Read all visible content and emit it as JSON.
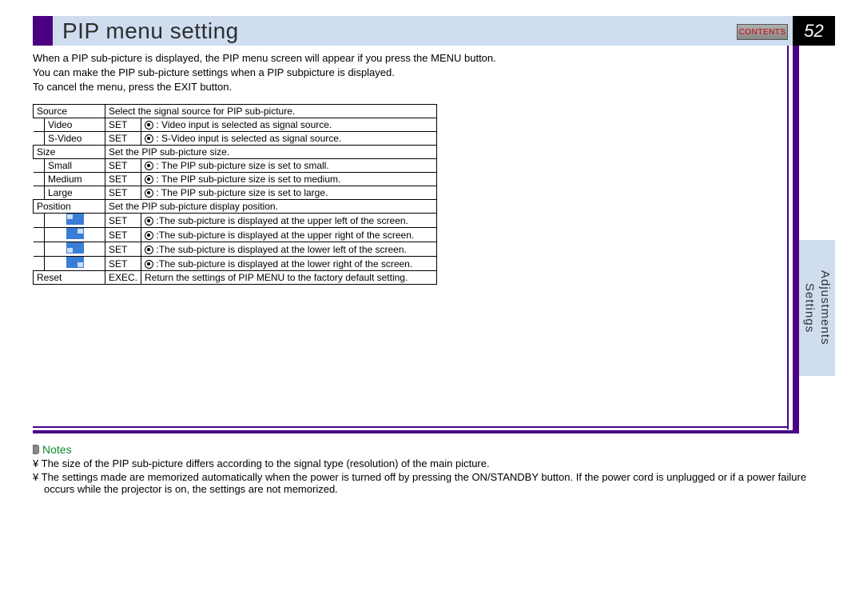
{
  "header": {
    "title": "PIP menu setting",
    "contents_label": "CONTENTS",
    "page_number": "52"
  },
  "side_tab": {
    "line1": "Adjustments",
    "line2": "Settings"
  },
  "intro": {
    "l1": "When a PIP sub-picture is displayed, the PIP menu screen will appear if you press the MENU button.",
    "l2": "You can make the PIP sub-picture settings when a PIP subpicture is displayed.",
    "l3": "To cancel the menu, press the EXIT button."
  },
  "tbl": {
    "source": {
      "label": "Source",
      "desc": "Select the signal source for PIP sub-picture.",
      "video": {
        "label": "Video",
        "tag": "SET",
        "desc": ": Video input is selected as signal source."
      },
      "svideo": {
        "label": "S-Video",
        "tag": "SET",
        "desc": ": S-Video input is selected as signal source."
      }
    },
    "size": {
      "label": "Size",
      "desc": "Set the PIP sub-picture size.",
      "small": {
        "label": "Small",
        "tag": "SET",
        "desc": ": The PIP sub-picture size is set to small."
      },
      "medium": {
        "label": "Medium",
        "tag": "SET",
        "desc": ": The PIP sub-picture size is set to medium."
      },
      "large": {
        "label": "Large",
        "tag": "SET",
        "desc": ": The PIP sub-picture size is set to large."
      }
    },
    "position": {
      "label": "Position",
      "desc": "Set the PIP sub-picture display position.",
      "ul": {
        "tag": "SET",
        "desc": ":The sub-picture is displayed at the upper left of the screen."
      },
      "ur": {
        "tag": "SET",
        "desc": ":The sub-picture is displayed at the upper right of the screen."
      },
      "ll": {
        "tag": "SET",
        "desc": ":The sub-picture is displayed at the lower left of the screen."
      },
      "lr": {
        "tag": "SET",
        "desc": ":The sub-picture is displayed at the lower right of the screen."
      }
    },
    "reset": {
      "label": "Reset",
      "tag": "EXEC.",
      "desc": "Return the settings of PIP MENU to the factory default setting."
    }
  },
  "notes": {
    "heading": "Notes",
    "bullet": "¥",
    "n1": "The size of the PIP sub-picture differs according to the signal type (resolution) of the main picture.",
    "n2": "The settings made are memorized automatically when the power is turned off by pressing the ON/STANDBY button. If the power cord is unplugged or if a power failure occurs while the projector is on, the settings are not memorized."
  }
}
